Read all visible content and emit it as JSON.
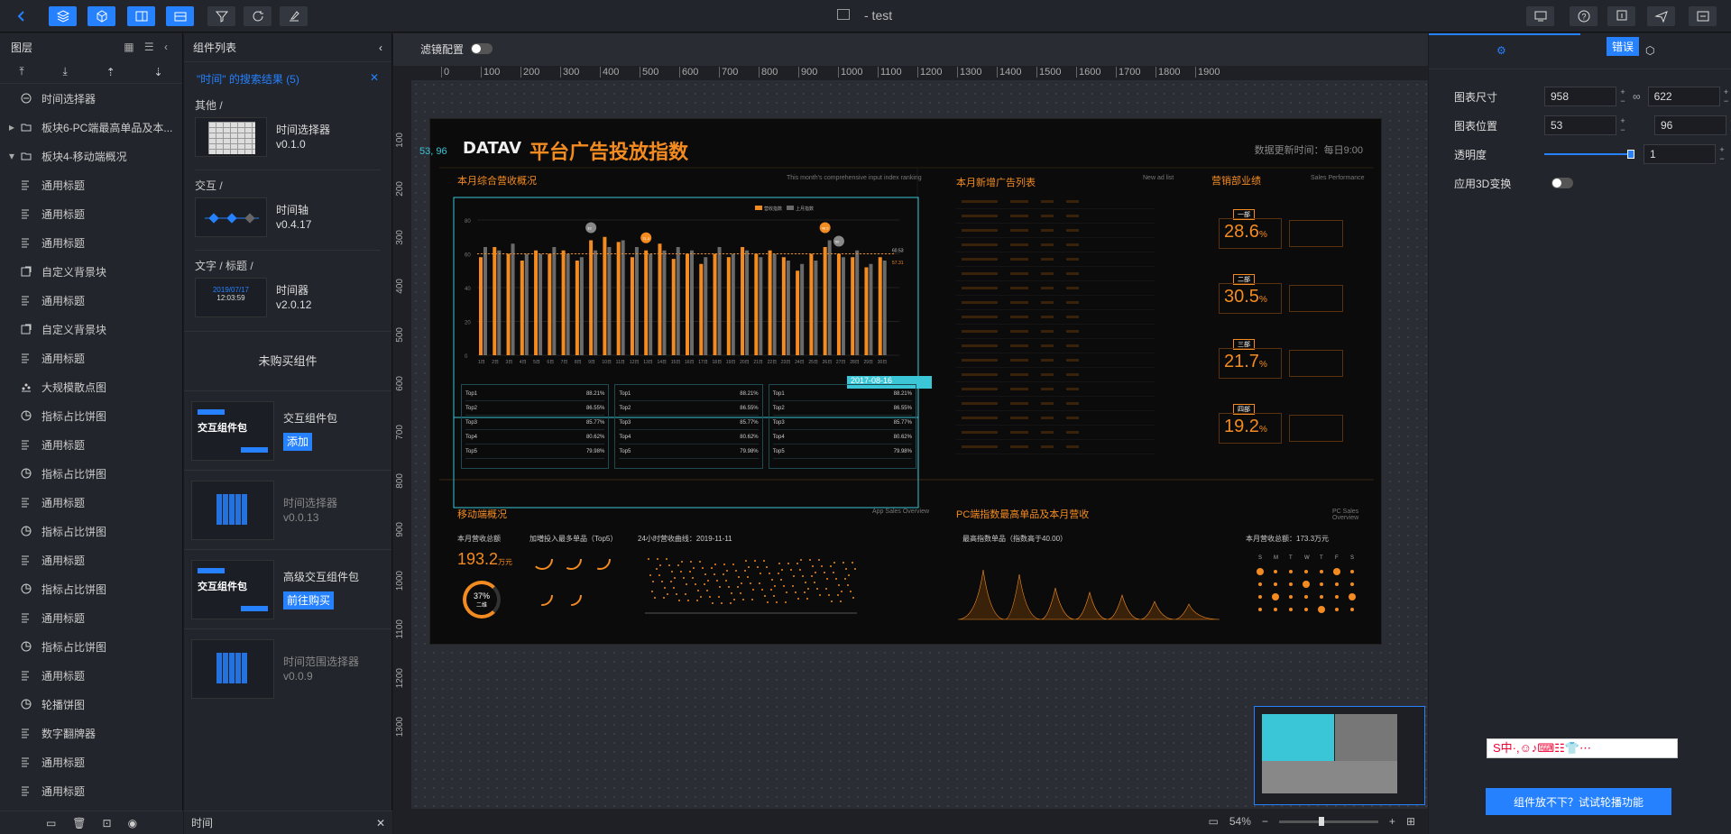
{
  "app": {
    "title": "- test"
  },
  "topbar": {
    "buttons_left": [
      "back",
      "layers",
      "box",
      "panel",
      "save"
    ],
    "tools": [
      "filter",
      "refresh",
      "clear"
    ],
    "buttons_right": [
      "preview",
      "help",
      "publish",
      "share",
      "exit"
    ],
    "error_badge": "错误"
  },
  "layers": {
    "header": "图层",
    "items": [
      {
        "label": "时间选择器",
        "icon": "circle-minus-icon",
        "group": true,
        "expand": ""
      },
      {
        "label": "板块6-PC端最高单品及本...",
        "icon": "folder-icon",
        "group": true,
        "expand": "▸"
      },
      {
        "label": "板块4-移动端概况",
        "icon": "folder-icon",
        "group": true,
        "expand": "▾"
      },
      {
        "label": "通用标题",
        "icon": "title-icon"
      },
      {
        "label": "通用标题",
        "icon": "title-icon"
      },
      {
        "label": "通用标题",
        "icon": "title-icon"
      },
      {
        "label": "自定义背景块",
        "icon": "bg-icon"
      },
      {
        "label": "通用标题",
        "icon": "title-icon"
      },
      {
        "label": "自定义背景块",
        "icon": "bg-icon"
      },
      {
        "label": "通用标题",
        "icon": "title-icon"
      },
      {
        "label": "大规模散点图",
        "icon": "scatter-icon"
      },
      {
        "label": "指标占比饼图",
        "icon": "pie-icon"
      },
      {
        "label": "通用标题",
        "icon": "title-icon"
      },
      {
        "label": "指标占比饼图",
        "icon": "pie-icon"
      },
      {
        "label": "通用标题",
        "icon": "title-icon"
      },
      {
        "label": "指标占比饼图",
        "icon": "pie-icon"
      },
      {
        "label": "通用标题",
        "icon": "title-icon"
      },
      {
        "label": "指标占比饼图",
        "icon": "pie-icon"
      },
      {
        "label": "通用标题",
        "icon": "title-icon"
      },
      {
        "label": "指标占比饼图",
        "icon": "pie-icon"
      },
      {
        "label": "通用标题",
        "icon": "title-icon"
      },
      {
        "label": "轮播饼图",
        "icon": "pie-icon"
      },
      {
        "label": "数字翻牌器",
        "icon": "title-icon"
      },
      {
        "label": "通用标题",
        "icon": "title-icon"
      },
      {
        "label": "通用标题",
        "icon": "title-icon"
      }
    ]
  },
  "components": {
    "header": "组件列表",
    "search_result": "\"时间\" 的搜索结果 (5)",
    "groups": [
      {
        "category": "其他 /",
        "name": "时间选择器",
        "version": "v0.1.0"
      },
      {
        "category": "交互 /",
        "name": "时间轴",
        "version": "v0.4.17"
      },
      {
        "category": "文字 / 标题 /",
        "name": "时间器",
        "version": "v2.0.12",
        "thumb_date": "2019/07/17",
        "thumb_time": "12:03:59"
      }
    ],
    "unpurchased": "未购买组件",
    "packs": [
      {
        "name": "交互组件包",
        "action": "添加",
        "thumb": "交互组件包"
      },
      {
        "name": "时间选择器",
        "version": "v0.0.13",
        "dim": true
      },
      {
        "name": "高级交互组件包",
        "action": "前往购买",
        "thumb": "交互组件包"
      },
      {
        "name": "时间范围选择器",
        "version": "v0.0.9",
        "dim": true
      }
    ],
    "footer_search": "时间"
  },
  "canvas": {
    "filter_label": "滤镜配置",
    "ruler_x": [
      "0",
      "100",
      "200",
      "300",
      "400",
      "500",
      "600",
      "700",
      "800",
      "900",
      "1000",
      "1100",
      "1200",
      "1300",
      "1400",
      "1500",
      "1600",
      "1700",
      "1800",
      "1900"
    ],
    "ruler_y": [
      "100",
      "200",
      "300",
      "400",
      "500",
      "600",
      "700",
      "800",
      "900",
      "1000",
      "1100",
      "1200",
      "1300"
    ],
    "coords": "53, 96",
    "date_tag": "2017-08-16",
    "zoom": "54%"
  },
  "dashboard": {
    "logo": "DATAV",
    "title": "平台广告投放指数",
    "update": "数据更新时间：每日9:00",
    "p1_title": "本月综合营收概况",
    "p1_sub": "This month's comprehensive input index ranking",
    "p2_title": "本月新增广告列表",
    "p2_sub": "New ad list",
    "p3_title": "营销部业绩",
    "p3_sub": "Sales Performance",
    "p4_title": "移动端概况",
    "p4_sub": "App Sales Overview",
    "p5_title": "PC端指数最高单品及本月营收",
    "p5_sub": "PC Sales Overview",
    "kpis": [
      {
        "dept": "一部",
        "value": "28.6",
        "unit": "%"
      },
      {
        "dept": "二部",
        "value": "30.5",
        "unit": "%"
      },
      {
        "dept": "三部",
        "value": "21.7",
        "unit": "%"
      },
      {
        "dept": "四部",
        "value": "19.2",
        "unit": "%"
      }
    ],
    "mobile_total_label": "本月营收总额",
    "mobile_total": "193.2",
    "mobile_unit": "万元",
    "mobile_pct": "37%",
    "mobile_pct_sub": "二维",
    "top5_label": "加増投入最多单品（Top5）",
    "scatter_label": "24小时营收曲线：2019-11-11",
    "pc_label1": "最高指数单品（指数高于40.00）",
    "pc_label2": "本月营收总额：173.3万元",
    "rank_rows": [
      "Top1",
      "Top2",
      "Top3",
      "Top4",
      "Top5"
    ],
    "rank_vals": [
      "88.21%",
      "86.55%",
      "85.77%",
      "80.62%",
      "79.98%"
    ],
    "week_days": [
      "S",
      "M",
      "T",
      "W",
      "T",
      "F",
      "S"
    ]
  },
  "chart_data": {
    "type": "bar",
    "categories": [
      "1日",
      "2日",
      "3日",
      "4日",
      "5日",
      "6日",
      "7日",
      "8日",
      "9日",
      "10日",
      "11日",
      "12日",
      "13日",
      "14日",
      "15日",
      "16日",
      "17日",
      "18日",
      "19日",
      "20日",
      "21日",
      "22日",
      "23日",
      "24日",
      "25日",
      "26日",
      "27日",
      "28日",
      "29日",
      "30日"
    ],
    "series": [
      {
        "name": "营收指数",
        "values": [
          58,
          64,
          60,
          56,
          62,
          60,
          62,
          56,
          68,
          70,
          67,
          58,
          62,
          66,
          57,
          60,
          54,
          60,
          58,
          64,
          60,
          62,
          58,
          50,
          60,
          64,
          60,
          58,
          52,
          58
        ]
      },
      {
        "name": "上月指数",
        "values": [
          64,
          62,
          66,
          60,
          60,
          64,
          60,
          58,
          62,
          64,
          68,
          64,
          60,
          62,
          64,
          62,
          58,
          64,
          60,
          62,
          58,
          60,
          56,
          54,
          56,
          68,
          58,
          62,
          54,
          56
        ]
      }
    ],
    "markers": [
      "33",
      "71.3",
      "50",
      "48.5"
    ],
    "yticks": [
      "0",
      "20",
      "40",
      "60",
      "80"
    ],
    "ylim": [
      0,
      80
    ],
    "line_labels": [
      "60.53",
      "57.31"
    ]
  },
  "properties": {
    "size_label": "图表尺寸",
    "width": "958",
    "height": "622",
    "pos_label": "图表位置",
    "x": "53",
    "y": "96",
    "opacity_label": "透明度",
    "opacity": "1",
    "threed_label": "应用3D变换",
    "cta": "组件放不下？试试轮播功能",
    "ime": "S中·,☺♪⌨☷👕⋯"
  },
  "colors": {
    "accent": "#2681ff",
    "orange": "#f38b20",
    "cyan": "#3ac6d6"
  }
}
